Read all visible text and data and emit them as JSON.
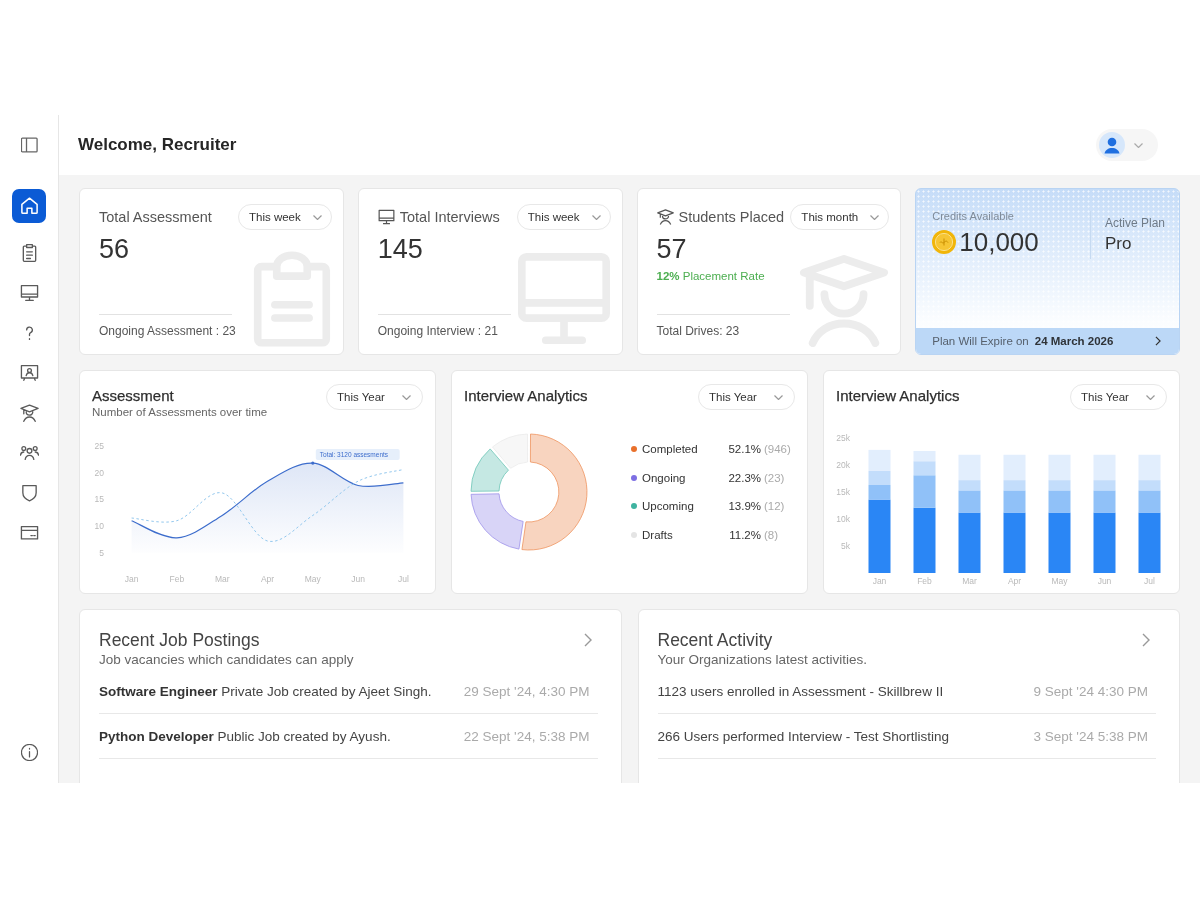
{
  "sidebar": {
    "items": [
      {
        "selected": true
      },
      {
        "selected": false
      },
      {
        "selected": false
      },
      {
        "selected": false
      },
      {
        "selected": false
      },
      {
        "selected": false
      },
      {
        "selected": false
      },
      {
        "selected": false
      },
      {
        "selected": false
      }
    ]
  },
  "header": {
    "title": "Welcome, Recruiter"
  },
  "stat_cards": [
    {
      "kind": "assessment",
      "title": "Total Assessment",
      "period": "This week",
      "value": "56",
      "footer": "Ongoing Assessment : 23"
    },
    {
      "kind": "interviews",
      "title": "Total Interviews",
      "period": "This week",
      "value": "145",
      "footer": "Ongoing Interview : 21"
    },
    {
      "kind": "placement",
      "title": "Students Placed",
      "period": "This month",
      "value": "57",
      "rate": "**12%** Placement Rate",
      "footer": "Total Drives: 23"
    }
  ],
  "credits": {
    "label": "Credits Available",
    "value": "10,000",
    "plan_label": "Active Plan",
    "plan": "Pro",
    "expiry_label": "Plan Will Expire on",
    "expiry_date": "24 March 2026"
  },
  "assessment_chart": {
    "title": "Assessment",
    "subtitle": "Number of Assessments over time",
    "period": "This Year",
    "chart_data": {
      "type": "area",
      "categories": [
        "Jan",
        "Feb",
        "Mar",
        "Apr",
        "May",
        "Jun",
        "Jul"
      ],
      "series": [
        {
          "color": "#3d6dcc",
          "line_style": "solid",
          "values": [
            11,
            7.8,
            12,
            18.4,
            21.8,
            17.6,
            18.1
          ]
        },
        {
          "color": "#93c8ee",
          "type": "line",
          "line_style": "dashed",
          "values": [
            11.5,
            11,
            16.2,
            7.2,
            12,
            18.4,
            20.6
          ]
        }
      ],
      "ylim": [
        5,
        25
      ],
      "yticks": [
        5,
        10,
        15,
        20,
        25
      ],
      "annotations": [
        {
          "x": "May",
          "y": 21.8,
          "text": "Total: 3120 assesments"
        }
      ]
    }
  },
  "interview_donut": {
    "title": "Interview Analytics",
    "period": "This Year",
    "chart_data": {
      "type": "donut",
      "values": [
        52.1,
        22.3,
        13.9,
        11.2
      ]
    },
    "legend": [
      {
        "label": "Completed",
        "percent": "52.1%",
        "count": "(946)",
        "color": "#e9702b"
      },
      {
        "label": "Ongoing",
        "percent": "22.3%",
        "count": "(23)",
        "color": "#7d6fe3"
      },
      {
        "label": "Upcoming",
        "percent": "13.9%",
        "count": "(12)",
        "color": "#3fb3a0"
      },
      {
        "label": "Drafts",
        "percent": "11.2%",
        "count": "(8)",
        "color": "#e4e4e4"
      }
    ]
  },
  "interview_bars": {
    "title": "Interview Analytics",
    "period": "This Year",
    "chart_data": {
      "type": "bar",
      "stacked": true,
      "categories": [
        "Jan",
        "Feb",
        "Mar",
        "Apr",
        "May",
        "Jun",
        "Jul"
      ],
      "series": [
        {
          "color": "#2a86f5",
          "values": [
            13600,
            12100,
            11200,
            11200,
            11200,
            11200,
            11200
          ]
        },
        {
          "color": "#90c1f8",
          "values": [
            2700,
            6000,
            4100,
            4100,
            4100,
            4100,
            4100
          ]
        },
        {
          "color": "#c3ddfb",
          "values": [
            2600,
            2600,
            1900,
            1900,
            1900,
            1900,
            1900
          ]
        },
        {
          "color": "#e2eefd",
          "values": [
            3900,
            1900,
            4700,
            4700,
            4700,
            4700,
            4700
          ]
        }
      ],
      "ylim": [
        0,
        25000
      ],
      "yticks": [
        {
          "value": 5000,
          "label": "5k"
        },
        {
          "value": 10000,
          "label": "10k"
        },
        {
          "value": 15000,
          "label": "15k"
        },
        {
          "value": 20000,
          "label": "20k"
        },
        {
          "value": 25000,
          "label": "25k"
        }
      ]
    }
  },
  "job_postings": {
    "title": "Recent Job Postings",
    "subtitle": "Job vacancies which candidates can apply",
    "rows": [
      {
        "text": "**Software Engineer** Private Job created by Ajeet Singh.",
        "time": "29 Sept '24, 4:30 PM"
      },
      {
        "text": "**Python Developer** Public Job created by Ayush.",
        "time": "22 Sept '24, 5:38 PM"
      }
    ]
  },
  "activity": {
    "title": "Recent Activity",
    "subtitle": "Your Organizations latest activities.",
    "rows": [
      {
        "text": "1123 users enrolled in Assessment - Skillbrew II",
        "time": "9 Sept '24 4:30 PM"
      },
      {
        "text": "266 Users performed Interview - Test Shortlisting",
        "time": "3 Sept '24 5:38 PM"
      }
    ]
  }
}
